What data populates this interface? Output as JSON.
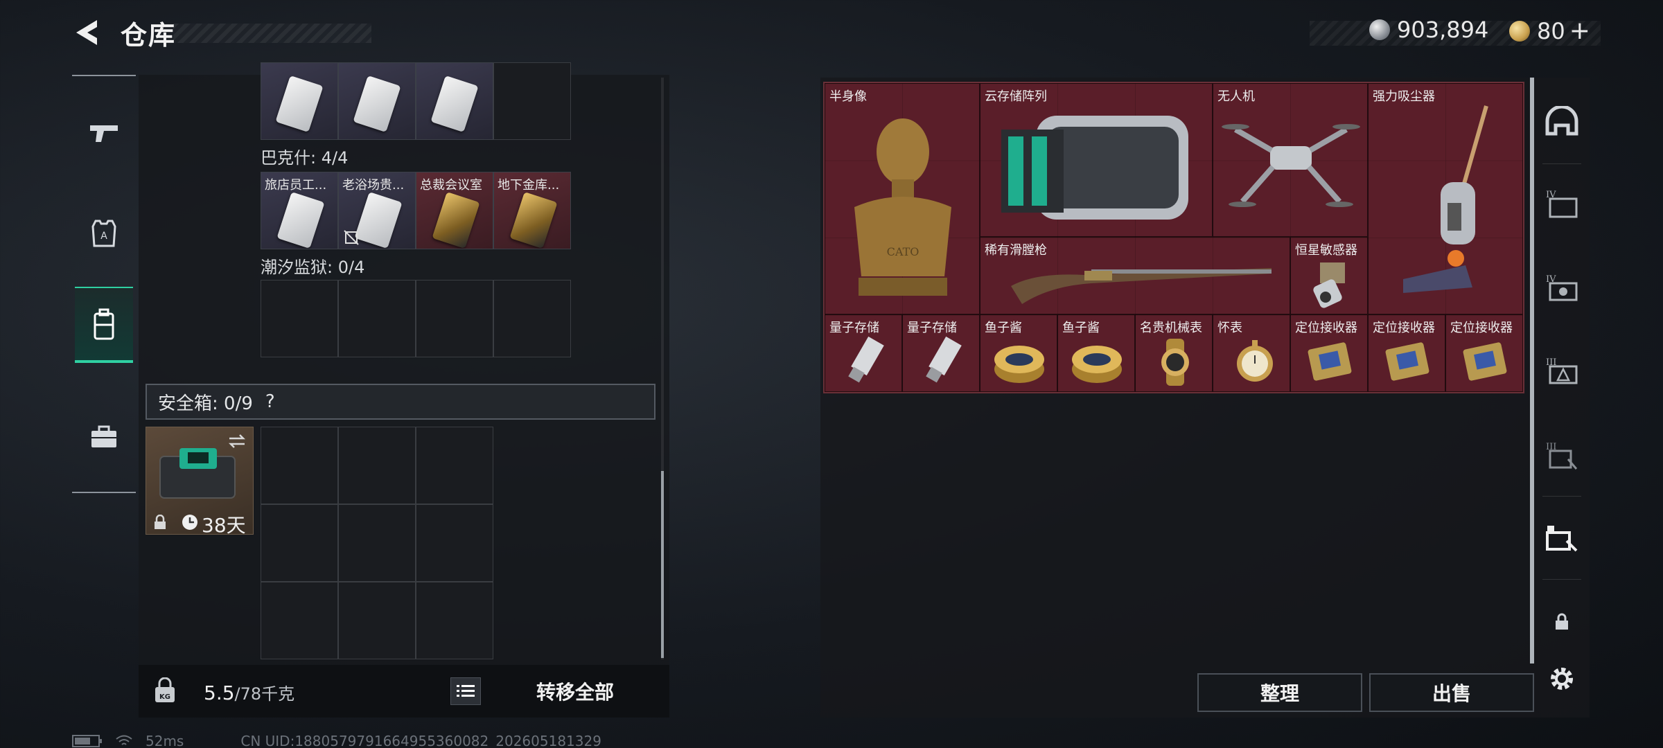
{
  "header": {
    "title": "仓库"
  },
  "currency": {
    "silver": "903,894",
    "gold": "80",
    "plus": "+"
  },
  "left_nav": {
    "items": [
      {
        "name": "weapons",
        "icon": "gun-icon"
      },
      {
        "name": "armor",
        "icon": "armor-icon"
      },
      {
        "name": "backpack",
        "icon": "backpack-icon",
        "active": true
      },
      {
        "name": "supplies",
        "icon": "briefcase-icon"
      }
    ]
  },
  "keycards": {
    "bakeshi_label": "巴克什: 4/4",
    "top_row": [
      "",
      "",
      ""
    ],
    "bakeshi_cards": [
      {
        "label": "旅店员工...",
        "style": "white"
      },
      {
        "label": "老浴场贵...",
        "style": "white",
        "locked": true
      },
      {
        "label": "总裁会议室",
        "style": "gold"
      },
      {
        "label": "地下金库...",
        "style": "gold"
      }
    ],
    "chaoxi_label": "潮汐监狱: 0/4"
  },
  "safebox": {
    "label": "安全箱: 0/9",
    "help": "?",
    "days": "38天"
  },
  "weight": {
    "current": "5.5",
    "max": "/78千克"
  },
  "transfer_all": "转移全部",
  "stash_items": [
    {
      "label": "半身像"
    },
    {
      "label": "云存储阵列"
    },
    {
      "label": "无人机"
    },
    {
      "label": "强力吸尘器"
    },
    {
      "label": "稀有滑膛枪"
    },
    {
      "label": "恒星敏感器"
    },
    {
      "label": "量子存储"
    },
    {
      "label": "量子存储"
    },
    {
      "label": "鱼子酱"
    },
    {
      "label": "鱼子酱"
    },
    {
      "label": "名贵机械表"
    },
    {
      "label": "怀表"
    },
    {
      "label": "定位接收器"
    },
    {
      "label": "定位接收器"
    },
    {
      "label": "定位接收器"
    }
  ],
  "bust_engraving": "CATO",
  "buttons": {
    "sort": "整理",
    "sell": "出售"
  },
  "status": {
    "ping": "52ms",
    "uid": "CN UID:1880579791664955360082_202605181329"
  },
  "colors": {
    "accent": "#2fd0a2",
    "stash_bg": "#5a1f2a"
  }
}
